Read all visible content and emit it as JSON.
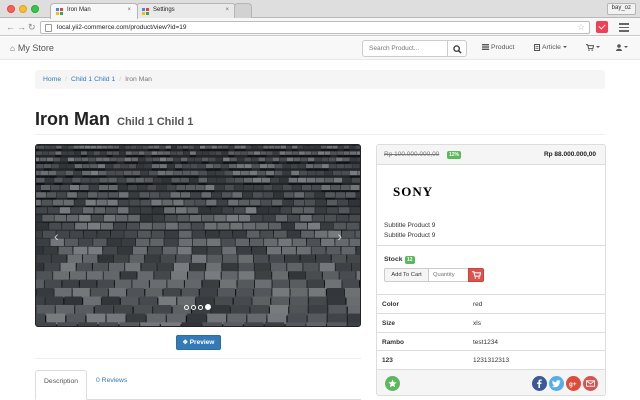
{
  "browser": {
    "tabs": [
      {
        "title": "Iron Man",
        "close_glyph": "×"
      },
      {
        "title": "Settings",
        "close_glyph": "×"
      }
    ],
    "profile_name": "bay_oz",
    "back_glyph": "←",
    "forward_glyph": "→",
    "reload_glyph": "↻",
    "url": "local.yii2-commerce.com/product/view?id=19",
    "star_glyph": "☆"
  },
  "navbar": {
    "brand": "My Store",
    "home_glyph": "⌂",
    "search_placeholder": "Search Product...",
    "product_label": "Product",
    "article_label": "Article"
  },
  "breadcrumb": {
    "items": [
      "Home",
      "Child 1 Child 1"
    ],
    "current": "Iron Man",
    "separator": "/"
  },
  "product": {
    "title": "Iron Man",
    "subtitle": "Child 1 Child 1",
    "old_price": "Rp 100.000.000,00",
    "discount": "12%",
    "new_price": "Rp 88.000.000,00",
    "brand_logo_text": "SONY",
    "subtitles": [
      "Subtitle Product 9",
      "Subtitle Product 9"
    ],
    "stock_label": "Stock",
    "stock_count": "12",
    "add_to_cart_label": "Add To Cart",
    "quantity_placeholder": "Quantity",
    "attributes": [
      {
        "name": "Color",
        "value": "red"
      },
      {
        "name": "Size",
        "value": "xls"
      },
      {
        "name": "Rambo",
        "value": "test1234"
      },
      {
        "name": "123",
        "value": "1231312313"
      }
    ]
  },
  "carousel": {
    "prev_glyph": "‹",
    "next_glyph": "›",
    "slide_count": 4,
    "active_index": 3
  },
  "preview_label": "Preview",
  "tabs": {
    "description": "Description",
    "reviews": "0 Reviews"
  },
  "colors": {
    "link": "#337ab7",
    "success": "#5cb85c",
    "danger": "#d9534f",
    "facebook": "#3b5998",
    "twitter": "#55acee",
    "google_plus": "#dd4b39"
  }
}
